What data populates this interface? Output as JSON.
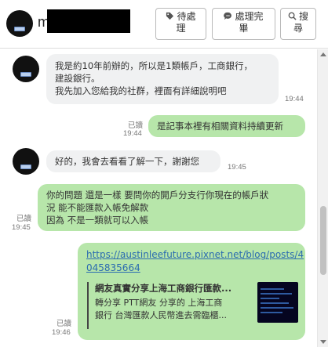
{
  "header": {
    "name_visible": "m",
    "buttons": [
      {
        "icon": "tag-icon",
        "line1": "待處",
        "line2": "理"
      },
      {
        "icon": "chat-bubble-icon",
        "line1": "處理完",
        "line2": "畢"
      },
      {
        "icon": "search-icon",
        "line1": "搜",
        "line2": "尋"
      }
    ]
  },
  "messages": [
    {
      "side": "in",
      "lines": [
        "我是約10年前辦的，所以是1類帳戶，工商銀行，",
        "建設銀行。",
        "我先加入您給我的社群，裡面有詳細說明吧"
      ],
      "time": "19:44"
    },
    {
      "side": "out",
      "read": "已讀",
      "time": "19:44",
      "lines": [
        "是記事本裡有相關資料持續更新"
      ]
    },
    {
      "side": "in",
      "lines": [
        "好的，我會去看看了解一下，謝謝您"
      ],
      "time": "19:45"
    },
    {
      "side": "out",
      "read": "已讀",
      "time": "19:45",
      "lines": [
        "你的問題  還是一樣  要問你的開戶分支行你現在的帳戶狀",
        "況  能不能匯款入帳免解款",
        "因為  不是一類就可以入帳"
      ]
    },
    {
      "side": "out",
      "read": "已讀",
      "time": "19:46",
      "link_lines": [
        "https://austinleefuture.pixnet.net/blog/posts/4",
        "045835664"
      ],
      "preview": {
        "title": "網友真實分享上海工商銀行匯款...",
        "desc_lines": [
          "轉分享 PTT網友 分享的 上海工商",
          "銀行 台灣匯款人民幣進去需臨櫃..."
        ]
      }
    }
  ],
  "colors": {
    "incoming_bubble": "#f0f1f2",
    "outgoing_bubble": "#b7e6aa",
    "link": "#2b6cb0"
  }
}
